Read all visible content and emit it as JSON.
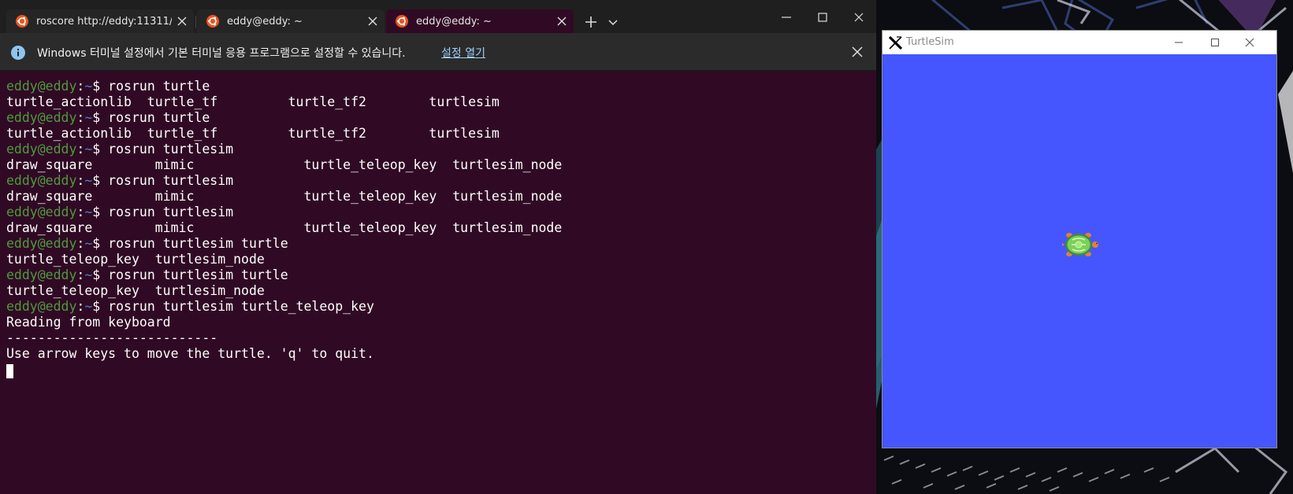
{
  "terminal": {
    "tabs": [
      {
        "label": "roscore http://eddy:11311/",
        "icon": "ubuntu-icon",
        "active": false
      },
      {
        "label": "eddy@eddy: ~",
        "icon": "ubuntu-icon",
        "active": false
      },
      {
        "label": "eddy@eddy: ~",
        "icon": "ubuntu-icon",
        "active": true
      }
    ],
    "new_tab_icon": "plus-icon",
    "dropdown_icon": "chevron-down-icon",
    "window_controls": [
      "minimize-icon",
      "maximize-icon",
      "close-icon"
    ],
    "infobar": {
      "icon": "info-icon",
      "message": "Windows 터미널 설정에서 기본 터미널 응용 프로그램으로 설정할 수 있습니다.",
      "link": "설정 열기"
    },
    "prompt": {
      "user": "eddy@eddy",
      "colon": ":",
      "path": "~",
      "dollar": "$"
    },
    "lines": [
      {
        "type": "prompt",
        "cmd": " rosrun turtle"
      },
      {
        "type": "out",
        "text": "turtle_actionlib  turtle_tf         turtle_tf2        turtlesim"
      },
      {
        "type": "prompt",
        "cmd": " rosrun turtle"
      },
      {
        "type": "out",
        "text": "turtle_actionlib  turtle_tf         turtle_tf2        turtlesim"
      },
      {
        "type": "prompt",
        "cmd": " rosrun turtlesim"
      },
      {
        "type": "out",
        "text": "draw_square        mimic              turtle_teleop_key  turtlesim_node"
      },
      {
        "type": "prompt",
        "cmd": " rosrun turtlesim"
      },
      {
        "type": "out",
        "text": "draw_square        mimic              turtle_teleop_key  turtlesim_node"
      },
      {
        "type": "prompt",
        "cmd": " rosrun turtlesim"
      },
      {
        "type": "out",
        "text": "draw_square        mimic              turtle_teleop_key  turtlesim_node"
      },
      {
        "type": "prompt",
        "cmd": " rosrun turtlesim turtle"
      },
      {
        "type": "out",
        "text": "turtle_teleop_key  turtlesim_node"
      },
      {
        "type": "prompt",
        "cmd": " rosrun turtlesim turtle"
      },
      {
        "type": "out",
        "text": "turtle_teleop_key  turtlesim_node"
      },
      {
        "type": "prompt",
        "cmd": " rosrun turtlesim turtle_teleop_key"
      },
      {
        "type": "out",
        "text": "Reading from keyboard"
      },
      {
        "type": "out",
        "text": "---------------------------"
      },
      {
        "type": "out",
        "text": "Use arrow keys to move the turtle. 'q' to quit."
      }
    ]
  },
  "turtlesim": {
    "title": "TurtleSim",
    "app_icon": "x11-icon",
    "window_controls": [
      "minimize-icon",
      "maximize-icon",
      "close-icon"
    ],
    "background_color": "#4556ff",
    "turtle_icon": "turtle-icon"
  },
  "colors": {
    "terminal_bg": "#300a24",
    "prompt_user": "#4e9a3e",
    "prompt_path": "#4b7ec9"
  }
}
